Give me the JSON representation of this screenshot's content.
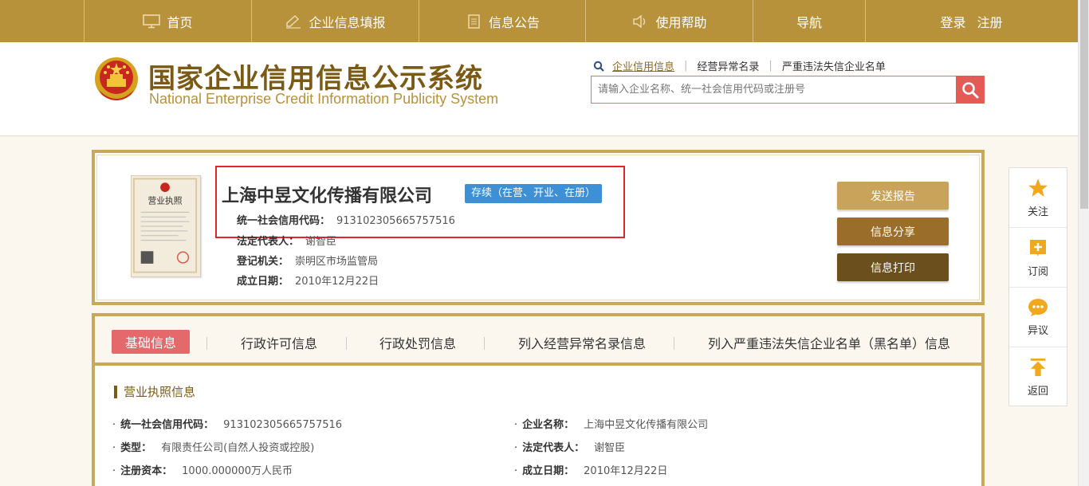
{
  "nav": {
    "items": [
      {
        "label": "首页",
        "icon": "monitor-icon"
      },
      {
        "label": "企业信息填报",
        "icon": "edit-icon"
      },
      {
        "label": "信息公告",
        "icon": "document-icon"
      },
      {
        "label": "使用帮助",
        "icon": "speaker-icon"
      },
      {
        "label": "导航",
        "icon": ""
      }
    ],
    "login": "登录",
    "register": "注册"
  },
  "brand": {
    "title_cn": "国家企业信用信息公示系统",
    "title_en": "National Enterprise Credit Information Publicity System"
  },
  "search": {
    "tabs": [
      "企业信用信息",
      "经营异常名录",
      "严重违法失信企业名单"
    ],
    "active_tab": 0,
    "placeholder": "请输入企业名称、统一社会信用代码或注册号"
  },
  "company": {
    "name": "上海中昱文化传播有限公司",
    "status": "存续（在营、开业、在册）",
    "credit_code_label": "统一社会信用代码：",
    "credit_code": "913102305665757516",
    "legal_rep_label": "法定代表人：",
    "legal_rep": "谢智臣",
    "authority_label": "登记机关：",
    "authority": "崇明区市场监管局",
    "established_label": "成立日期：",
    "established": "2010年12月22日"
  },
  "actions": {
    "report": "发送报告",
    "share": "信息分享",
    "print": "信息打印"
  },
  "tabs": [
    "基础信息",
    "行政许可信息",
    "行政处罚信息",
    "列入经营异常名录信息",
    "列入严重违法失信企业名单（黑名单）信息"
  ],
  "basic": {
    "section_title": "营业执照信息",
    "left": [
      {
        "label": "统一社会信用代码：",
        "value": "913102305665757516"
      },
      {
        "label": "类型：",
        "value": "有限责任公司(自然人投资或控股)"
      },
      {
        "label": "注册资本：",
        "value": "1000.000000万人民币"
      }
    ],
    "right": [
      {
        "label": "企业名称：",
        "value": "上海中昱文化传播有限公司"
      },
      {
        "label": "法定代表人：",
        "value": "谢智臣"
      },
      {
        "label": "成立日期：",
        "value": "2010年12月22日"
      }
    ]
  },
  "floatbar": {
    "items": [
      {
        "label": "关注",
        "icon": "star-icon"
      },
      {
        "label": "订阅",
        "icon": "plus-icon"
      },
      {
        "label": "异议",
        "icon": "chat-icon"
      },
      {
        "label": "返回",
        "icon": "arrow-up-icon"
      }
    ]
  },
  "colors": {
    "nav_bg": "#b8913b",
    "brand": "#7a5a14",
    "status_badge": "#3d8fd6",
    "search_btn": "#e45a55",
    "highlight_box": "#e2262b",
    "active_tab": "#e5686a",
    "float_icon": "#f0a81c"
  }
}
